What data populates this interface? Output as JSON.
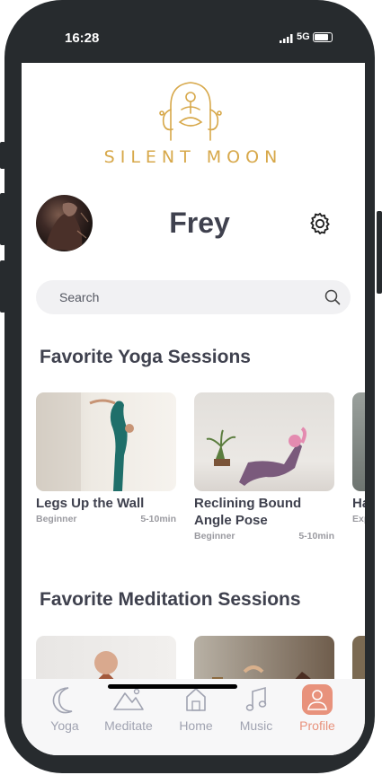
{
  "status_bar": {
    "time": "16:28",
    "network": "5G"
  },
  "header": {
    "brand": "SILENT MOON",
    "user_name": "Frey"
  },
  "search": {
    "placeholder": "Search"
  },
  "sections": {
    "yoga": {
      "title": "Favorite Yoga Sessions",
      "cards": [
        {
          "title": "Legs Up the Wall",
          "level": "Beginner",
          "duration": "5-10min"
        },
        {
          "title": "Reclining Bound Angle Pose",
          "level": "Beginner",
          "duration": "5-10min"
        },
        {
          "title": "Ha",
          "level": "Exp"
        }
      ]
    },
    "meditation": {
      "title": "Favorite Meditation Sessions"
    }
  },
  "tabs": [
    {
      "label": "Yoga",
      "icon": "moon-icon"
    },
    {
      "label": "Meditate",
      "icon": "mountains-icon"
    },
    {
      "label": "Home",
      "icon": "home-icon"
    },
    {
      "label": "Music",
      "icon": "music-note-icon"
    },
    {
      "label": "Profile",
      "icon": "user-icon",
      "active": true
    }
  ],
  "colors": {
    "accent": "#e8927c",
    "brand_gold": "#d7a84a",
    "text_dark": "#3f414e",
    "muted": "#a0a3b1"
  }
}
